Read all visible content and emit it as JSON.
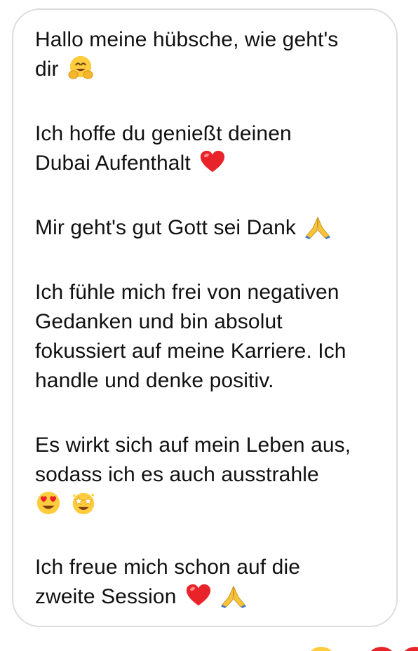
{
  "message": {
    "paragraphs": [
      {
        "lines": [
          "Hallo meine hübsche, wie geht's",
          "dir"
        ],
        "emoji": [
          "hugging-face-icon"
        ]
      },
      {
        "lines": [
          "Ich hoffe du genießt deinen",
          "Dubai Aufenthalt"
        ],
        "emoji": [
          "red-heart-icon"
        ]
      },
      {
        "lines": [
          "Mir geht's gut Gott sei Dank"
        ],
        "emoji": [
          "folded-hands-icon"
        ]
      },
      {
        "lines": [
          "Ich fühle mich frei von negativen",
          "Gedanken und bin absolut",
          "fokussiert auf meine Karriere. Ich",
          "handle und denke positiv."
        ],
        "emoji": []
      },
      {
        "lines": [
          "Es wirkt sich auf mein Leben aus,",
          "sodass ich es auch ausstrahle"
        ],
        "emoji": [
          "heart-eyes-face-icon",
          "star-struck-face-icon"
        ]
      },
      {
        "lines": [
          "Ich freue mich schon auf die",
          "zweite Session"
        ],
        "emoji": [
          "red-heart-icon",
          "folded-hands-icon"
        ]
      }
    ]
  },
  "colors": {
    "text": "#111111",
    "bubble_border": "#dcdcdc",
    "background": "#ffffff"
  }
}
